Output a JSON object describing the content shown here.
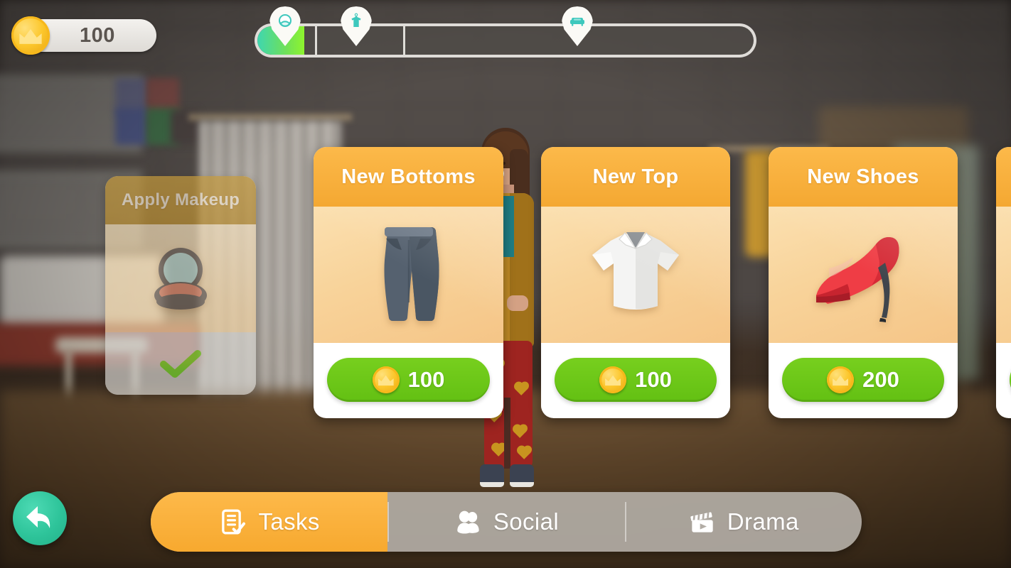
{
  "hud": {
    "currency": {
      "icon": "coin-crown-icon",
      "amount": "100"
    },
    "progress": {
      "fill_percent": 9.5,
      "segments": [
        {
          "name": "makeup",
          "icon": "face-makeup-icon",
          "position_percent": 6,
          "reached": true
        },
        {
          "name": "clothing",
          "icon": "shirt-hanger-icon",
          "position_percent": 20,
          "reached": false
        },
        {
          "name": "furniture",
          "icon": "sofa-icon",
          "position_percent": 64,
          "reached": false
        }
      ],
      "dividers_percent": [
        11.6,
        29.3
      ]
    }
  },
  "cards": [
    {
      "id": "apply-makeup",
      "title": "Apply Makeup",
      "art": "makeup-compact-icon",
      "state": "completed",
      "footer_icon": "green-check-icon",
      "price": null
    },
    {
      "id": "new-bottoms",
      "title": "New Bottoms",
      "art": "jeans-icon",
      "state": "available",
      "price": "100",
      "price_icon": "coin-crown-icon"
    },
    {
      "id": "new-top",
      "title": "New Top",
      "art": "shirt-icon",
      "state": "available",
      "price": "100",
      "price_icon": "coin-crown-icon"
    },
    {
      "id": "new-shoes",
      "title": "New Shoes",
      "art": "high-heel-icon",
      "state": "available",
      "price": "200",
      "price_icon": "coin-crown-icon"
    },
    {
      "id": "next-card-partial",
      "title": "",
      "art": "",
      "state": "available",
      "price": "",
      "price_icon": "coin-crown-icon"
    }
  ],
  "nav": {
    "back": {
      "icon": "back-arrow-icon",
      "label": ""
    },
    "tabs": [
      {
        "id": "tasks",
        "label": "Tasks",
        "icon": "checklist-icon",
        "active": true
      },
      {
        "id": "social",
        "label": "Social",
        "icon": "people-icon",
        "active": false
      },
      {
        "id": "drama",
        "label": "Drama",
        "icon": "clapperboard-icon",
        "active": false
      }
    ]
  },
  "colors": {
    "card_header_orange": "#f4a832",
    "card_body_cream": "#f8d39a",
    "price_green": "#6bc518",
    "coin_gold": "#fcc72c",
    "progress_fill_start": "#3fd6b0",
    "progress_fill_end": "#8ef42d",
    "back_button_teal": "#2ec49a",
    "tab_active_orange": "#f7a92f",
    "tab_inactive_gray": "#b2aca5",
    "check_green": "#79dd2e"
  }
}
